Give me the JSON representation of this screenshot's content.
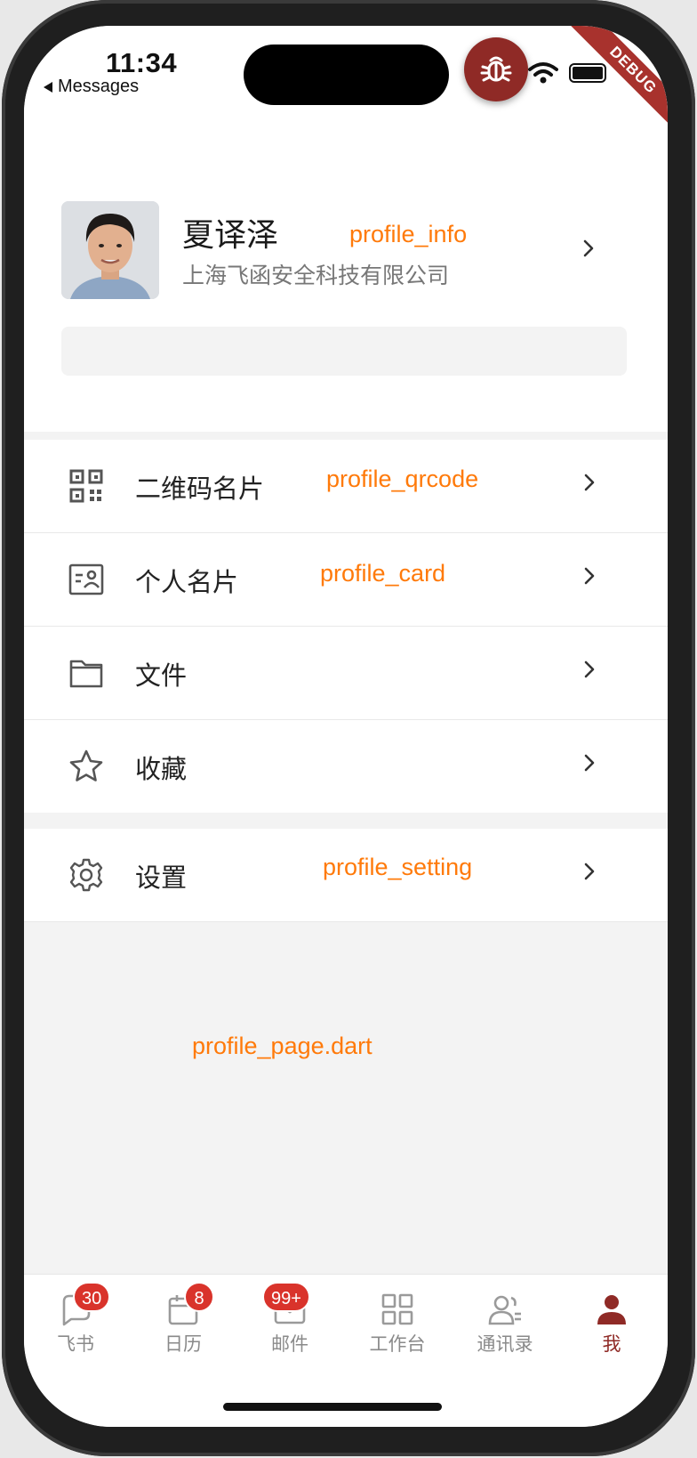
{
  "status_bar": {
    "time": "11:34",
    "back_label": "Messages",
    "debug_banner": "DEBUG"
  },
  "profile": {
    "name": "夏译泽",
    "company": "上海飞函安全科技有限公司",
    "annotation": "profile_info"
  },
  "menu": {
    "items": [
      {
        "label": "二维码名片",
        "icon": "qrcode-icon",
        "annotation": "profile_qrcode"
      },
      {
        "label": "个人名片",
        "icon": "id-card-icon",
        "annotation": "profile_card"
      },
      {
        "label": "文件",
        "icon": "folder-icon",
        "annotation": ""
      },
      {
        "label": "收藏",
        "icon": "star-icon",
        "annotation": ""
      }
    ],
    "settings": {
      "label": "设置",
      "icon": "gear-icon",
      "annotation": "profile_setting"
    }
  },
  "page_annotation": "profile_page.dart",
  "tabbar": {
    "tabs": [
      {
        "label": "飞书",
        "icon": "chat-icon",
        "badge": "30"
      },
      {
        "label": "日历",
        "icon": "calendar-icon",
        "badge": "8"
      },
      {
        "label": "邮件",
        "icon": "mail-icon",
        "badge": "99+"
      },
      {
        "label": "工作台",
        "icon": "grid-icon",
        "badge": ""
      },
      {
        "label": "通讯录",
        "icon": "contacts-icon",
        "badge": ""
      },
      {
        "label": "我",
        "icon": "person-icon",
        "badge": ""
      }
    ]
  },
  "colors": {
    "accent": "#8f2a26",
    "badge": "#d9332b",
    "annotation": "#ff7a0a",
    "background": "#f3f3f3"
  }
}
